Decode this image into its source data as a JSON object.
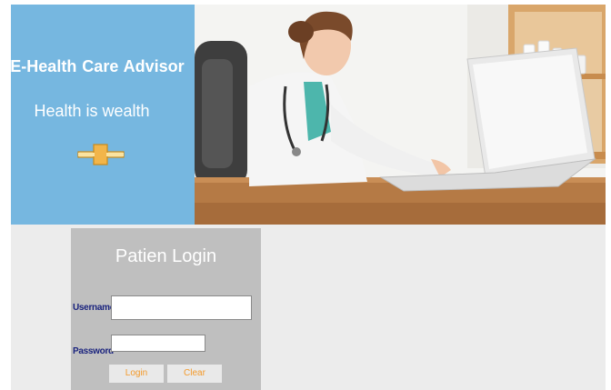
{
  "header": {
    "app_title": "E-Health Care  Advisor",
    "slogan": "Health is wealth",
    "logo_icon": "medical-cross-icon",
    "hero_image": "doctor-at-laptop-photo"
  },
  "login": {
    "title": "Patien Login",
    "username_label": "Username",
    "username_value": "",
    "password_label": "Password",
    "password_value": "",
    "login_button": "Login",
    "clear_button": "Clear"
  },
  "colors": {
    "brand_panel": "#76b7e0",
    "login_panel": "#bfbfbf",
    "content_background": "#ececec",
    "label_text": "#1a237e",
    "button_text": "#f39a2b"
  }
}
